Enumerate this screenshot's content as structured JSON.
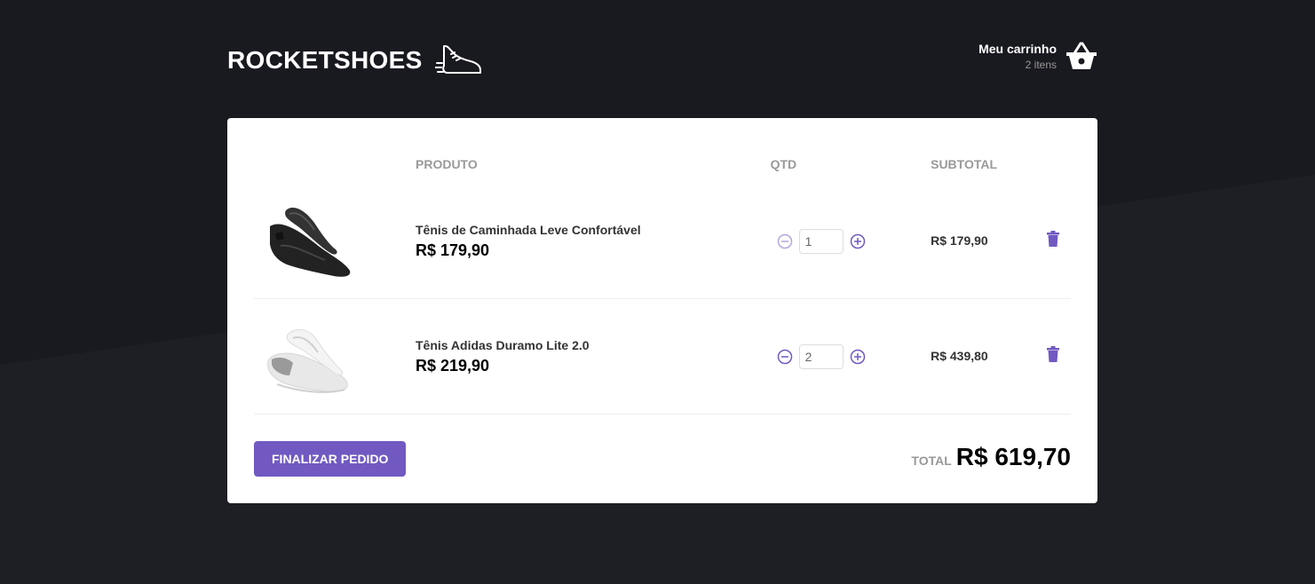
{
  "header": {
    "logo_text": "ROCKETSHOES",
    "logo_icon": "running-shoe-icon",
    "cart_title": "Meu carrinho",
    "cart_count": "2 itens",
    "cart_icon": "basket-icon"
  },
  "table": {
    "columns": [
      "",
      "PRODUTO",
      "QTD",
      "SUBTOTAL",
      ""
    ],
    "rows": [
      {
        "image": "black-sneaker",
        "title": "Tênis de Caminhada Leve Confortável",
        "price": "R$ 179,90",
        "quantity": "1",
        "subtotal": "R$ 179,90",
        "decrement_disabled": true
      },
      {
        "image": "white-sneaker",
        "title": "Tênis Adidas Duramo Lite 2.0",
        "price": "R$ 219,90",
        "quantity": "2",
        "subtotal": "R$ 439,80",
        "decrement_disabled": false
      }
    ]
  },
  "footer": {
    "checkout_label": "FINALIZAR PEDIDO",
    "total_label": "TOTAL",
    "total_value": "R$ 619,70"
  },
  "colors": {
    "background": "#191920",
    "accent": "#7159c1",
    "card": "#ffffff"
  }
}
